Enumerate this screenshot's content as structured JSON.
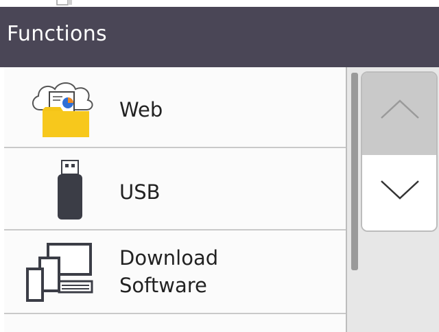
{
  "header": {
    "title": "Functions"
  },
  "items": [
    {
      "label_line1": "Web",
      "label_line2": "",
      "icon": "cloud-web-folder-icon"
    },
    {
      "label_line1": "USB",
      "label_line2": "",
      "icon": "usb-drive-icon"
    },
    {
      "label_line1": "Download",
      "label_line2": "Software",
      "icon": "devices-icon"
    },
    {
      "label_line1": "",
      "label_line2": "",
      "icon": ""
    }
  ],
  "scroll": {
    "up": "chevron-up-icon",
    "down": "chevron-down-icon"
  },
  "colors": {
    "header_bg": "#4a4656",
    "folder": "#f5c518",
    "usb": "#3b3d46",
    "accent_blue": "#2f6fd6"
  }
}
